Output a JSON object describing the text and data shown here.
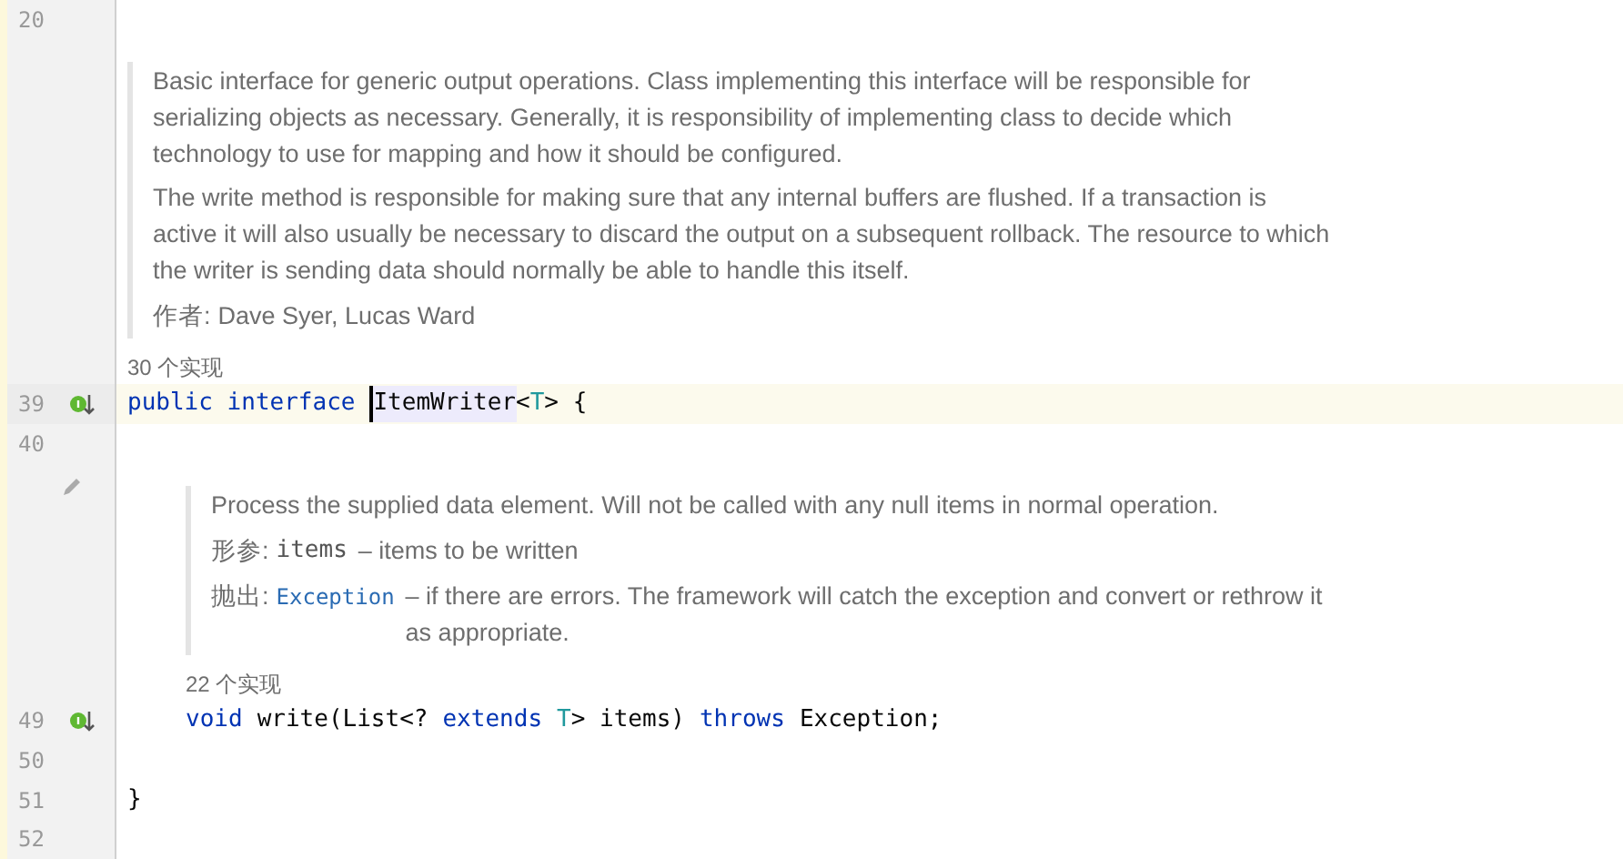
{
  "editor": {
    "rows": [
      {
        "kind": "code",
        "number": "20",
        "current": false,
        "gutter_icon": false,
        "tokens": []
      },
      {
        "kind": "doc",
        "edit_icon": false,
        "indent": false,
        "paragraphs": [
          "Basic interface for generic output operations. Class implementing this interface will be responsible for serializing objects as necessary. Generally, it is responsibility of implementing class to decide which technology to use for mapping and how it should be configured.",
          "The write method is responsible for making sure that any internal buffers are flushed. If a transaction is active it will also usually be necessary to discard the output on a subsequent rollback. The resource to which the writer is sending data should normally be able to handle this itself."
        ],
        "tags": [
          {
            "label": "作者:",
            "kind": "plain",
            "text": "Dave Syer, Lucas Ward"
          }
        ]
      },
      {
        "kind": "hint",
        "indent": false,
        "text": "30 个实现"
      },
      {
        "kind": "code",
        "number": "39",
        "current": true,
        "gutter_icon": true,
        "indent": false,
        "tokens": [
          {
            "text": "public interface",
            "kind": "keyword"
          },
          {
            "text": "ItemWriter",
            "kind": "caret"
          },
          {
            "text": "<",
            "kind": "plain"
          },
          {
            "text": "T",
            "kind": "param"
          },
          {
            "text": "> {",
            "kind": "plain"
          }
        ]
      },
      {
        "kind": "code",
        "number": "40",
        "current": false,
        "gutter_icon": false,
        "tokens": []
      },
      {
        "kind": "doc",
        "edit_icon": true,
        "indent": true,
        "paragraphs": [
          "Process the supplied data element. Will not be called with any null items in normal operation."
        ],
        "tags": [
          {
            "label": "形参:",
            "kind": "name",
            "code": "items",
            "text": "– items to be written"
          },
          {
            "label": "抛出:",
            "kind": "link",
            "code": "Exception",
            "text": "– if there are errors. The framework will catch the exception and convert or rethrow it as appropriate."
          }
        ]
      },
      {
        "kind": "hint",
        "indent": true,
        "text": "22 个实现"
      },
      {
        "kind": "code",
        "number": "49",
        "current": false,
        "gutter_icon": true,
        "indent": true,
        "tokens": [
          {
            "text": "void",
            "kind": "keyword"
          },
          {
            "text": "write(List<?",
            "kind": "plain"
          },
          {
            "text": "extends",
            "kind": "keyword"
          },
          {
            "text": "T",
            "kind": "param"
          },
          {
            "text": "> items)",
            "kind": "plain"
          },
          {
            "text": "throws",
            "kind": "keyword"
          },
          {
            "text": "Exception;",
            "kind": "plain"
          }
        ]
      },
      {
        "kind": "code",
        "number": "50",
        "current": false,
        "gutter_icon": false,
        "tokens": []
      },
      {
        "kind": "code",
        "number": "51",
        "current": false,
        "gutter_icon": false,
        "indent": false,
        "tokens": [
          {
            "text": "}",
            "kind": "plain"
          }
        ]
      },
      {
        "kind": "code",
        "number": "52",
        "current": false,
        "gutter_icon": false,
        "tokens": []
      }
    ]
  }
}
